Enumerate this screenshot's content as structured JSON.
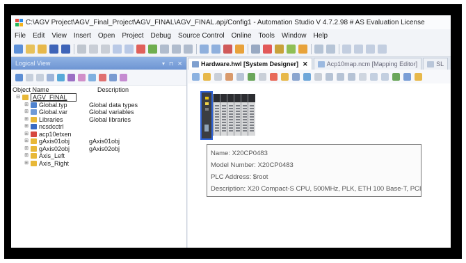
{
  "window": {
    "title": "C:\\AGV Project\\AGV_Final_Project\\AGV_FINAL\\AGV_FINAL.apj/Config1 - Automation Studio V 4.7.2.98 # AS Evaluation License"
  },
  "menu": [
    "File",
    "Edit",
    "View",
    "Insert",
    "Open",
    "Project",
    "Debug",
    "Source Control",
    "Online",
    "Tools",
    "Window",
    "Help"
  ],
  "logical_view": {
    "header": "Logical View",
    "header_buttons": [
      "▾",
      "⊓",
      "✕"
    ],
    "columns": {
      "name": "Object Name",
      "description": "Description"
    },
    "root": {
      "name": "AGV_FINAL",
      "expander": "⊟"
    },
    "items": [
      {
        "name": "Global.typ",
        "description": "Global data types",
        "icon": "typ-file-icon"
      },
      {
        "name": "Global.var",
        "description": "Global variables",
        "icon": "var-file-icon"
      },
      {
        "name": "Libraries",
        "description": "Global libraries",
        "icon": "folder-icon"
      },
      {
        "name": "ncsdcctrl",
        "description": "",
        "icon": "nc-object-icon"
      },
      {
        "name": "acp10etxen",
        "description": "",
        "icon": "error-text-icon"
      },
      {
        "name": "gAxis01obj",
        "description": "gAxis01obj",
        "icon": "folder-icon"
      },
      {
        "name": "gAxis02obj",
        "description": "gAxis02obj",
        "icon": "folder-icon"
      },
      {
        "name": "Axis_Left",
        "description": "",
        "icon": "folder-icon"
      },
      {
        "name": "Axis_Right",
        "description": "",
        "icon": "folder-icon"
      }
    ],
    "expander": "⊞"
  },
  "tabs": [
    {
      "label": "Hardware.hwl [System Designer]",
      "active": true,
      "close": "✕"
    },
    {
      "label": "Acp10map.ncm [Mapping Editor]",
      "active": false
    },
    {
      "label": "SL",
      "active": false
    }
  ],
  "tooltip": {
    "name": "Name: X20CP0483",
    "model": "Model Number: X20CP0483",
    "address": "PLC Address: $root",
    "description": "Description: X20 Compact-S CPU, 500MHz, PLK, ETH 100 Base-T, PCI"
  },
  "colors": {
    "frame": "#000000",
    "panel_header": "#7aa0da",
    "selection_outline": "#2f63d8",
    "led": "#e9c414"
  }
}
